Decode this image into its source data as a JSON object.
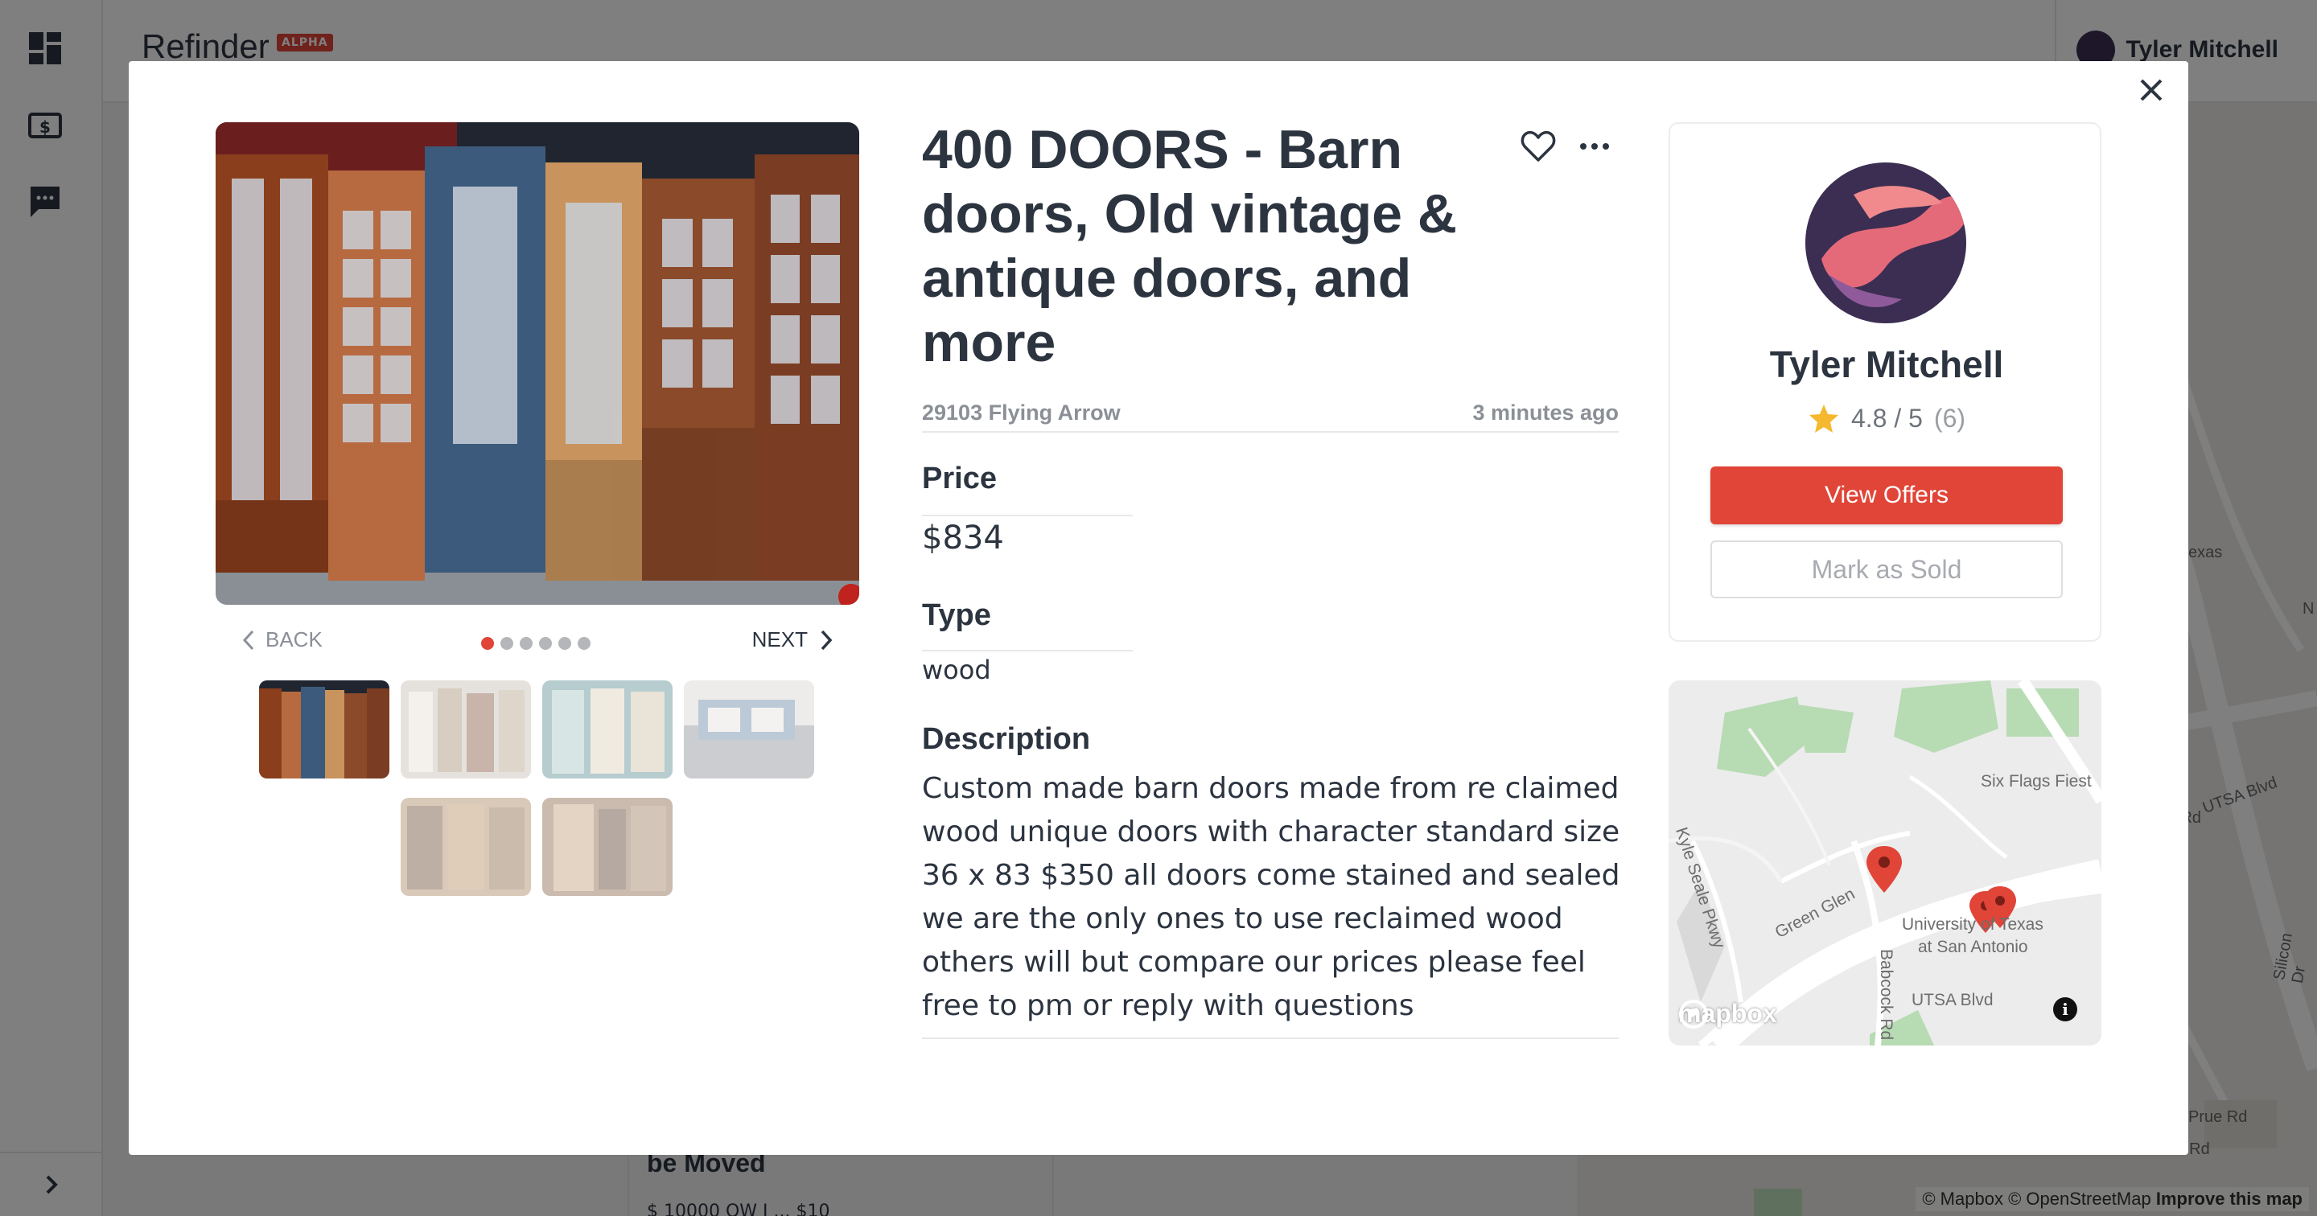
{
  "app": {
    "name": "Refinder",
    "badge": "ALPHA",
    "user_name": "Tyler Mitchell"
  },
  "sidebar": {
    "items": [
      {
        "icon": "dashboard-icon"
      },
      {
        "icon": "dollar-icon"
      },
      {
        "icon": "chat-icon"
      }
    ],
    "expand_icon": "chevron-right-icon"
  },
  "background": {
    "listing_title_fragment": "be Moved",
    "listing_sub_fragment": "$ 10000 OW I ... $10",
    "map_labels": {
      "texas": "exas",
      "n": "N",
      "utsa_blvd": "UTSA Blvd",
      "man_rd": "man Rd",
      "silicon_dr": "Silicon Dr",
      "prue_rd": "Prue Rd",
      "ockhill_rd": "ockhill Rd"
    },
    "attribution": {
      "mapbox": "© Mapbox",
      "osm": "© OpenStreetMap",
      "improve": "Improve this map"
    }
  },
  "modal": {
    "close_icon": "close-icon",
    "gallery": {
      "back_label": "BACK",
      "next_label": "NEXT",
      "photo_count": 6,
      "active_index": 0
    },
    "listing": {
      "title": "400 DOORS - Barn doors, Old vintage & antique doors, and more",
      "location": "29103 Flying Arrow",
      "posted": "3 minutes ago",
      "price_label": "Price",
      "price": "$834",
      "type_label": "Type",
      "type": "wood",
      "description_label": "Description",
      "description": "Custom made barn doors made from re claimed wood unique doors with character standard size 36 x 83 $350 all doors come stained and sealed we are the only ones to use reclaimed wood others will but compare our prices please feel free to pm or reply with questions"
    },
    "seller": {
      "name": "Tyler Mitchell",
      "rating": "4.8",
      "rating_max": "5",
      "rating_sep": "/",
      "review_count": "(6)",
      "view_offers_label": "View Offers",
      "mark_sold_label": "Mark as Sold"
    },
    "map": {
      "labels": {
        "six_flags": "Six Flags Fiest",
        "kyle_seale": "Kyle Seale Pkwy",
        "green_glen": "Green Glen",
        "university": "University of Texas",
        "at_san_antonio": "at San Antonio",
        "babcock": "Babcock Rd",
        "utsa_blvd": "UTSA Blvd"
      },
      "logo": "mapbox",
      "info_glyph": "i"
    },
    "colors": {
      "accent": "#e04538",
      "text": "#2c3440",
      "muted": "#8b8f96"
    }
  }
}
